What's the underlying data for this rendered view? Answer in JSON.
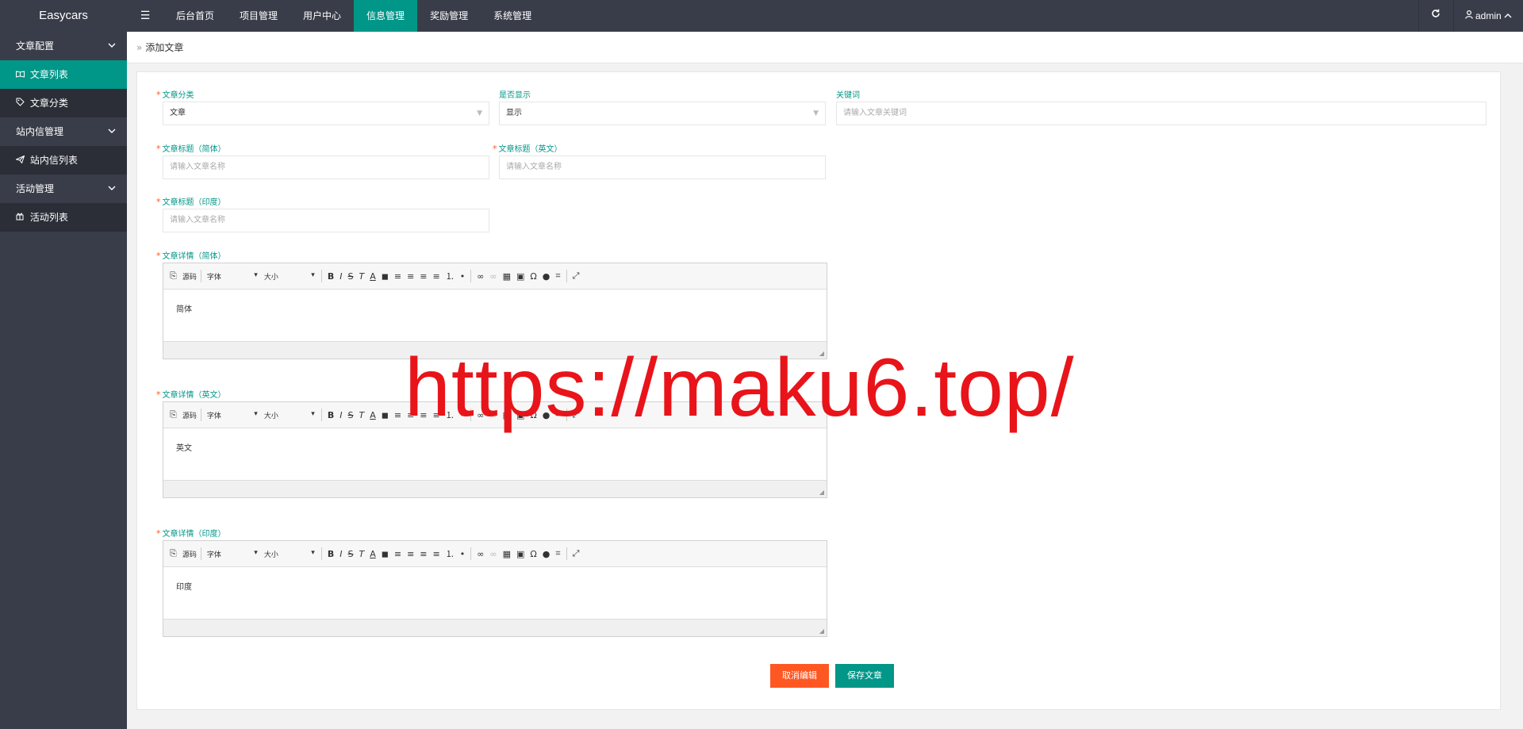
{
  "app": {
    "logo": "Easycars",
    "menu_icon": "☰"
  },
  "nav": [
    "后台首页",
    "项目管理",
    "用户中心",
    "信息管理",
    "奖励管理",
    "系统管理"
  ],
  "nav_active": "信息管理",
  "top_right": {
    "refresh_icon": "refresh-icon",
    "user": "admin"
  },
  "sidebar": {
    "groups": [
      {
        "label": "文章配置",
        "items": [
          {
            "label": "文章列表",
            "active": true,
            "icon": "book-icon"
          },
          {
            "label": "文章分类",
            "active": false,
            "icon": "tag-icon"
          }
        ]
      },
      {
        "label": "站内信管理",
        "items": [
          {
            "label": "站内信列表",
            "active": false,
            "icon": "send-icon"
          }
        ]
      },
      {
        "label": "活动管理",
        "items": [
          {
            "label": "活动列表",
            "active": false,
            "icon": "gift-icon"
          }
        ]
      }
    ]
  },
  "breadcrumb": "添加文章",
  "form": {
    "category": {
      "label": "文章分类",
      "value": "文章"
    },
    "display": {
      "label": "是否显示",
      "value": "显示"
    },
    "keywords": {
      "label": "关键词",
      "placeholder": "请输入文章关键词"
    },
    "title_cn": {
      "label": "文章标题（简体）",
      "placeholder": "请输入文章名称"
    },
    "title_en": {
      "label": "文章标题（英文）",
      "placeholder": "请输入文章名称"
    },
    "title_in": {
      "label": "文章标题（印度）",
      "placeholder": "请输入文章名称"
    },
    "detail_cn": {
      "label": "文章详情（简体）",
      "content": "简体"
    },
    "detail_en": {
      "label": "文章详情（英文）",
      "content": "英文"
    },
    "detail_in": {
      "label": "文章详情（印度）",
      "content": "印度"
    }
  },
  "editor_toolbar": {
    "source": "源码",
    "font": "字体",
    "size": "大小"
  },
  "buttons": {
    "cancel": "取消编辑",
    "save": "保存文章"
  },
  "watermark": "https://maku6.top/",
  "colors": {
    "accent": "#009688",
    "danger": "#ff5722",
    "dark": "#393d49"
  }
}
